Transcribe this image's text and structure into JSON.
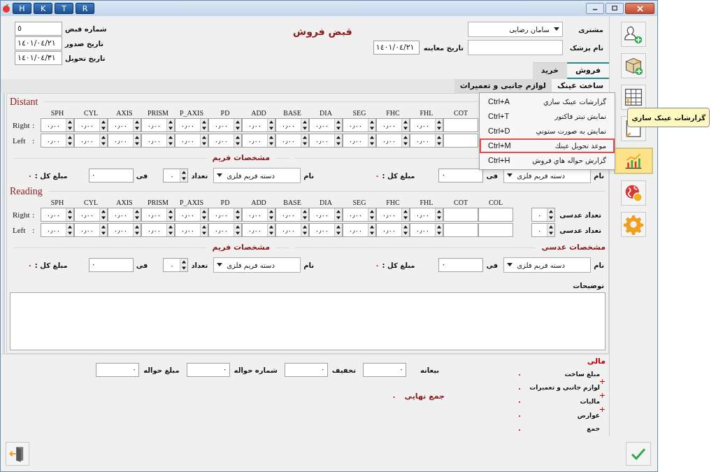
{
  "window": {
    "title_buttons": [
      "R",
      "T",
      "K",
      "H"
    ]
  },
  "receipt": {
    "number_label": "شماره قبض",
    "number": "٥",
    "issue_label": "تاریخ صدور",
    "issue_date": "١٤٠١/٠٤/٢١",
    "delivery_label": "تاریخ تحویل",
    "delivery_date": "١٤٠١/٠٤/٣١"
  },
  "title": "قبض فروش",
  "customer": {
    "label": "مشتری",
    "value": "سامان رضایی"
  },
  "doctor": {
    "label": "نام پزشک"
  },
  "exam": {
    "label": "تاریخ معاینه",
    "value": "١٤٠١/٠٤/٢١"
  },
  "tabs": [
    {
      "label": "فروش",
      "selected": true
    },
    {
      "label": "خرید",
      "selected": false
    }
  ],
  "subtabs": [
    {
      "label": "ساخت عینک",
      "selected": true
    },
    {
      "label": "لوازم جانبی و تعمیرات",
      "selected": false
    }
  ],
  "sections": [
    {
      "title": "Distant",
      "columns": [
        {
          "label": "COT",
          "kind": "text"
        },
        {
          "label": "FHL",
          "kind": "spinner"
        },
        {
          "label": "FHC",
          "kind": "spinner"
        },
        {
          "label": "SEG",
          "kind": "spinner"
        },
        {
          "label": "DIA",
          "kind": "spinner"
        },
        {
          "label": "BASE",
          "kind": "spinner"
        },
        {
          "label": "ADD",
          "kind": "spinner"
        },
        {
          "label": "PD",
          "kind": "spinner"
        },
        {
          "label": "P_AXIS",
          "kind": "spinner"
        },
        {
          "label": "PRISM",
          "kind": "spinner"
        },
        {
          "label": "AXIS",
          "kind": "spinner"
        },
        {
          "label": "CYL",
          "kind": "spinner"
        },
        {
          "label": "SPH",
          "kind": "spinner"
        }
      ],
      "rows": [
        {
          "label": "Right",
          "colon": ":",
          "values": [
            "٠٫٠٠",
            "٠٫٠٠",
            "٠٫٠٠",
            "٠٫٠٠",
            "٠٫٠٠",
            "٠٫٠٠",
            "٠٫٠٠",
            "٠٫٠٠",
            "٠٫٠٠",
            "٠٫٠٠",
            "٠٫٠٠",
            "٠٫٠٠"
          ]
        },
        {
          "label": "Left",
          "colon": ":",
          "values": [
            "٠٫٠٠",
            "٠٫٠٠",
            "٠٫٠٠",
            "٠٫٠٠",
            "٠٫٠٠",
            "٠٫٠٠",
            "٠٫٠٠",
            "٠٫٠٠",
            "٠٫٠٠",
            "٠٫٠٠",
            "٠٫٠٠",
            "٠٫٠٠"
          ]
        }
      ],
      "specs": [
        {
          "kind": "lens",
          "name_label": "نام",
          "name": "دسته فریم فلزی",
          "price_label": "فی",
          "price": "٠",
          "total_label": "مبلغ کل :",
          "total": "٠"
        },
        {
          "kind": "frame",
          "heading": "مشخصات فریم",
          "name_label": "نام",
          "name": "دسته فریم فلزی",
          "qty_label": "تعداد",
          "qty": "٠",
          "price_label": "فی",
          "price": "٠",
          "total_label": "مبلغ کل :",
          "total": "٠"
        }
      ]
    },
    {
      "title": "Reading",
      "columns": [
        {
          "label": "COL",
          "kind": "text"
        },
        {
          "label": "COT",
          "kind": "text"
        },
        {
          "label": "FHL",
          "kind": "spinner"
        },
        {
          "label": "FHC",
          "kind": "spinner"
        },
        {
          "label": "SEG",
          "kind": "spinner"
        },
        {
          "label": "DIA",
          "kind": "spinner"
        },
        {
          "label": "BASE",
          "kind": "spinner"
        },
        {
          "label": "ADD",
          "kind": "spinner"
        },
        {
          "label": "PD",
          "kind": "spinner"
        },
        {
          "label": "P_AXIS",
          "kind": "spinner"
        },
        {
          "label": "PRISM",
          "kind": "spinner"
        },
        {
          "label": "AXIS",
          "kind": "spinner"
        },
        {
          "label": "CYL",
          "kind": "spinner"
        },
        {
          "label": "SPH",
          "kind": "spinner"
        }
      ],
      "rows": [
        {
          "label": "Right",
          "colon": ":",
          "values": [
            "٠٫٠٠",
            "٠٫٠٠",
            "٠٫٠٠",
            "٠٫٠٠",
            "٠٫٠٠",
            "٠٫٠٠",
            "٠٫٠٠",
            "٠٫٠٠",
            "٠٫٠٠",
            "٠٫٠٠",
            "٠٫٠٠",
            "٠٫٠٠"
          ],
          "count_label": "تعداد عدسی",
          "count": "٠"
        },
        {
          "label": "Left",
          "colon": ":",
          "values": [
            "٠٫٠٠",
            "٠٫٠٠",
            "٠٫٠٠",
            "٠٫٠٠",
            "٠٫٠٠",
            "٠٫٠٠",
            "٠٫٠٠",
            "٠٫٠٠",
            "٠٫٠٠",
            "٠٫٠٠",
            "٠٫٠٠",
            "٠٫٠٠"
          ],
          "count_label": "تعداد عدسی",
          "count": "٠"
        }
      ],
      "specs": [
        {
          "kind": "lens",
          "heading": "مشخصات عدسی",
          "name_label": "نام",
          "name": "دسته فریم فلزی",
          "price_label": "فی",
          "price": "٠",
          "total_label": "مبلغ کل :",
          "total": "٠"
        },
        {
          "kind": "frame",
          "heading": "مشخصات فریم",
          "name_label": "نام",
          "name": "دسته فریم فلزی",
          "qty_label": "تعداد",
          "qty": "٠",
          "price_label": "فی",
          "price": "٠",
          "total_label": "مبلغ کل :",
          "total": "٠"
        }
      ]
    }
  ],
  "notes": {
    "label": "توضیحات"
  },
  "finance": {
    "title": "مالی",
    "items": [
      {
        "label": "مبلغ ساخت",
        "value": "٠"
      },
      {
        "prefix": "+",
        "label": "لوازم جانبی و تعمیرات",
        "value": "٠"
      },
      {
        "prefix": "+",
        "label": "مالیات",
        "value": "٠"
      },
      {
        "prefix": "+",
        "label": "عوارض",
        "value": "٠"
      },
      {
        "label": "جمع",
        "value": "٠"
      }
    ],
    "payments": [
      {
        "label": "بیعانه",
        "value": "٠"
      },
      {
        "label": "تخفیف",
        "value": "٠"
      },
      {
        "label": "شماره حواله",
        "value": "٠"
      },
      {
        "label": "مبلغ حواله",
        "value": "٠"
      }
    ],
    "grand_total": {
      "label": "جمع نهایی",
      "value": "٠"
    }
  },
  "sidebar": [
    {
      "kind": "person-add",
      "selected": false
    },
    {
      "kind": "box-add",
      "selected": false
    },
    {
      "kind": "price-table",
      "selected": false
    },
    {
      "kind": "document",
      "selected": false
    },
    {
      "kind": "chart",
      "selected": true
    },
    {
      "kind": "globe-coin",
      "selected": false
    },
    {
      "kind": "gear",
      "selected": false
    }
  ],
  "menu": [
    {
      "label": "گزارشات عینک سازي",
      "shortcut": "Ctrl+A",
      "selected": false
    },
    {
      "label": "نمایش تیتر فاکتور",
      "shortcut": "Ctrl+T",
      "selected": false
    },
    {
      "label": "نمایش به صورت ستوني",
      "shortcut": "Ctrl+D",
      "selected": false
    },
    {
      "label": "موعد تحویل عینك",
      "shortcut": "Ctrl+M",
      "selected": true
    },
    {
      "label": "گزارش حواله هاي فروش",
      "shortcut": "Ctrl+H",
      "selected": false
    }
  ],
  "tooltip": {
    "text": "گزارشات عینک سازي"
  }
}
